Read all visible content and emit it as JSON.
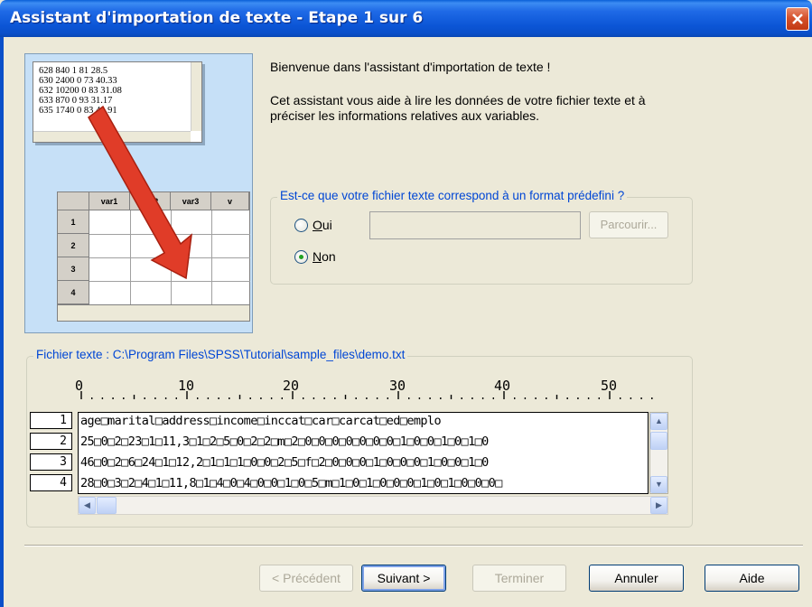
{
  "window": {
    "title": "Assistant d'importation de texte - Etape 1 sur 6"
  },
  "illustration": {
    "text_lines": [
      "628 840 1 81 28.5",
      "630 2400 0 73 40.33",
      "632 10200 0 83 31.08",
      "633 870 0 93 31.17",
      "635 1740 0 83 41.91"
    ],
    "grid_headers": [
      "var1",
      "var2",
      "var3",
      "v"
    ],
    "grid_rows": [
      "1",
      "2",
      "3",
      "4"
    ],
    "arrow_color": "#E03C28"
  },
  "welcome": "Bienvenue dans l'assistant d'importation de texte !",
  "description": "Cet assistant vous aide à lire les données de votre fichier texte et à préciser les informations relatives aux variables.",
  "format_group": {
    "legend": "Est-ce que votre fichier texte correspond à un format prédefini ?",
    "oui_label": "Oui",
    "non_label": "Non",
    "selected": "Non",
    "browse_label": "Parcourir..."
  },
  "file_group": {
    "legend": "Fichier texte : C:\\Program Files\\SPSS\\Tutorial\\sample_files\\demo.txt",
    "ruler": [
      "0",
      "10",
      "20",
      "30",
      "40",
      "50"
    ],
    "row_numbers": [
      "1",
      "2",
      "3",
      "4"
    ],
    "lines": [
      "age□marital□address□income□inccat□car□carcat□ed□emplo",
      "25□0□2□23□1□11,3□1□2□5□0□2□2□m□2□0□0□0□0□0□0□0□1□0□0□1□0□1□0",
      "46□0□2□6□24□1□12,2□1□1□1□0□0□2□5□f□2□0□0□0□1□0□0□0□1□0□0□1□0",
      "28□0□3□2□4□1□11,8□1□4□0□4□0□0□1□0□5□m□1□0□1□0□0□0□1□0□1□0□0□0□"
    ]
  },
  "buttons": {
    "prev": "< Précédent",
    "next": "Suivant >",
    "finish": "Terminer",
    "cancel": "Annuler",
    "help": "Aide"
  }
}
